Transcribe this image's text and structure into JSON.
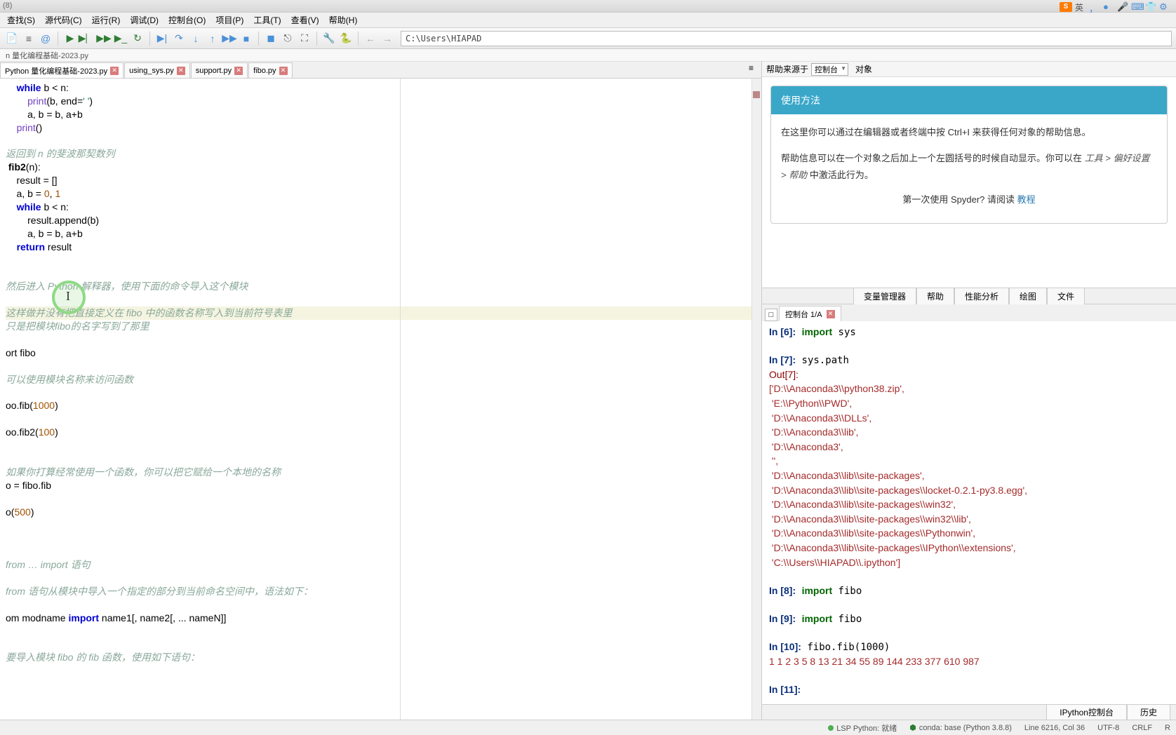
{
  "title_left": "(8)",
  "menu": [
    "查找(S)",
    "源代码(C)",
    "运行(R)",
    "调试(D)",
    "控制台(O)",
    "项目(P)",
    "工具(T)",
    "查看(V)",
    "帮助(H)"
  ],
  "toolbar_path": "C:\\Users\\HIAPAD",
  "path_bar": "n 量化编程基础-2023.py",
  "editor_tabs": [
    {
      "label": "Python 量化编程基础-2023.py",
      "active": true,
      "dirty": true
    },
    {
      "label": "using_sys.py",
      "active": false,
      "dirty": true
    },
    {
      "label": "support.py",
      "active": false,
      "dirty": true
    },
    {
      "label": "fibo.py",
      "active": false,
      "dirty": true
    }
  ],
  "code_lines": [
    {
      "type": "code",
      "html": "    <span class='kw'>while</span> b &lt; n:"
    },
    {
      "type": "code",
      "html": "        <span class='builtin'>print</span>(b, end=<span class='str'>' '</span>)"
    },
    {
      "type": "code",
      "html": "        a, b = b, a+b"
    },
    {
      "type": "code",
      "html": "    <span class='builtin'>print</span>()"
    },
    {
      "type": "blank"
    },
    {
      "type": "comment",
      "text": "返回到 n 的斐波那契数列"
    },
    {
      "type": "code",
      "html": " <span class='fn'>fib2</span>(n):"
    },
    {
      "type": "code",
      "html": "    result = []"
    },
    {
      "type": "code",
      "html": "    a, b = <span class='num'>0</span>, <span class='num'>1</span>"
    },
    {
      "type": "code",
      "html": "    <span class='kw'>while</span> b &lt; n:"
    },
    {
      "type": "code",
      "html": "        result.append(b)"
    },
    {
      "type": "code",
      "html": "        a, b = b, a+b"
    },
    {
      "type": "code",
      "html": "    <span class='kw'>return</span> result"
    },
    {
      "type": "blank"
    },
    {
      "type": "blank"
    },
    {
      "type": "comment",
      "text": "然后进入 Python 解释器，使用下面的命令导入这个模块"
    },
    {
      "type": "blank"
    },
    {
      "type": "hl-comment",
      "text": "这样做并没有把直接定义在 fibo 中的函数名称写入到当前符号表里"
    },
    {
      "type": "comment",
      "text": "只是把模块fibo的名字写到了那里"
    },
    {
      "type": "blank"
    },
    {
      "type": "code",
      "html": "ort fibo"
    },
    {
      "type": "blank"
    },
    {
      "type": "comment",
      "text": "可以使用模块名称来访问函数"
    },
    {
      "type": "blank"
    },
    {
      "type": "code",
      "html": "oo.fib(<span class='num'>1000</span>)"
    },
    {
      "type": "blank"
    },
    {
      "type": "code",
      "html": "oo.fib2(<span class='num'>100</span>)"
    },
    {
      "type": "blank"
    },
    {
      "type": "blank"
    },
    {
      "type": "comment",
      "text": "如果你打算经常使用一个函数，你可以把它赋给一个本地的名称"
    },
    {
      "type": "code",
      "html": "o = fibo.fib"
    },
    {
      "type": "blank"
    },
    {
      "type": "code",
      "html": "o(<span class='num'>500</span>)"
    },
    {
      "type": "blank"
    },
    {
      "type": "blank"
    },
    {
      "type": "blank"
    },
    {
      "type": "comment",
      "text": "from … import 语句"
    },
    {
      "type": "blank"
    },
    {
      "type": "comment",
      "text": "from 语句从模块中导入一个指定的部分到当前命名空间中，语法如下："
    },
    {
      "type": "blank"
    },
    {
      "type": "code",
      "html": "om modname <span class='kw'>import</span> name1[, name2[, ... nameN]]"
    },
    {
      "type": "blank"
    },
    {
      "type": "blank"
    },
    {
      "type": "comment",
      "text": "要导入模块 fibo 的 fib 函数，使用如下语句："
    }
  ],
  "help": {
    "label_source": "帮助来源于",
    "combo": "控制台",
    "label_object": "对象",
    "card_title": "使用方法",
    "p1": "在这里你可以通过在编辑器或者终端中按 Ctrl+I 来获得任何对象的帮助信息。",
    "p2_a": "帮助信息可以在一个对象之后加上一个左圆括号的时候自动显示。你可以在 ",
    "p2_path": "工具 > 偏好设置 > 帮助",
    "p2_b": " 中激活此行为。",
    "footer_a": "第一次使用 Spyder? 请阅读 ",
    "footer_link": "教程"
  },
  "mid_tabs": [
    "变量管理器",
    "帮助",
    "性能分析",
    "绘图",
    "文件"
  ],
  "console_tab": "控制台 1/A",
  "console_lines": [
    {
      "in": 6,
      "code": "import sys"
    },
    {
      "blank": true
    },
    {
      "in": 7,
      "code": "sys.path"
    },
    {
      "out": 7
    },
    {
      "raw": "['D:\\\\Anaconda3\\\\python38.zip',"
    },
    {
      "raw": " 'E:\\\\Python\\\\PWD',"
    },
    {
      "raw": " 'D:\\\\Anaconda3\\\\DLLs',"
    },
    {
      "raw": " 'D:\\\\Anaconda3\\\\lib',"
    },
    {
      "raw": " 'D:\\\\Anaconda3',"
    },
    {
      "raw": " '',"
    },
    {
      "raw": " 'D:\\\\Anaconda3\\\\lib\\\\site-packages',"
    },
    {
      "raw": " 'D:\\\\Anaconda3\\\\lib\\\\site-packages\\\\locket-0.2.1-py3.8.egg',"
    },
    {
      "raw": " 'D:\\\\Anaconda3\\\\lib\\\\site-packages\\\\win32',"
    },
    {
      "raw": " 'D:\\\\Anaconda3\\\\lib\\\\site-packages\\\\win32\\\\lib',"
    },
    {
      "raw": " 'D:\\\\Anaconda3\\\\lib\\\\site-packages\\\\Pythonwin',"
    },
    {
      "raw": " 'D:\\\\Anaconda3\\\\lib\\\\site-packages\\\\IPython\\\\extensions',"
    },
    {
      "raw": " 'C:\\\\Users\\\\HIAPAD\\\\.ipython']"
    },
    {
      "blank": true
    },
    {
      "in": 8,
      "code": "import fibo"
    },
    {
      "blank": true
    },
    {
      "in": 9,
      "code": "import fibo"
    },
    {
      "blank": true
    },
    {
      "in": 10,
      "code": "fibo.fib(1000)"
    },
    {
      "raw": "1 1 2 3 5 8 13 21 34 55 89 144 233 377 610 987"
    },
    {
      "blank": true
    },
    {
      "in": 11,
      "code": ""
    }
  ],
  "bottom_tabs": [
    "IPython控制台",
    "历史"
  ],
  "status": {
    "lsp": "LSP Python: 就绪",
    "conda": "conda: base (Python 3.8.8)",
    "pos": "Line 6216, Col 36",
    "enc": "UTF-8",
    "eol": "CRLF",
    "perm": "R"
  },
  "ime": {
    "label": "英"
  }
}
